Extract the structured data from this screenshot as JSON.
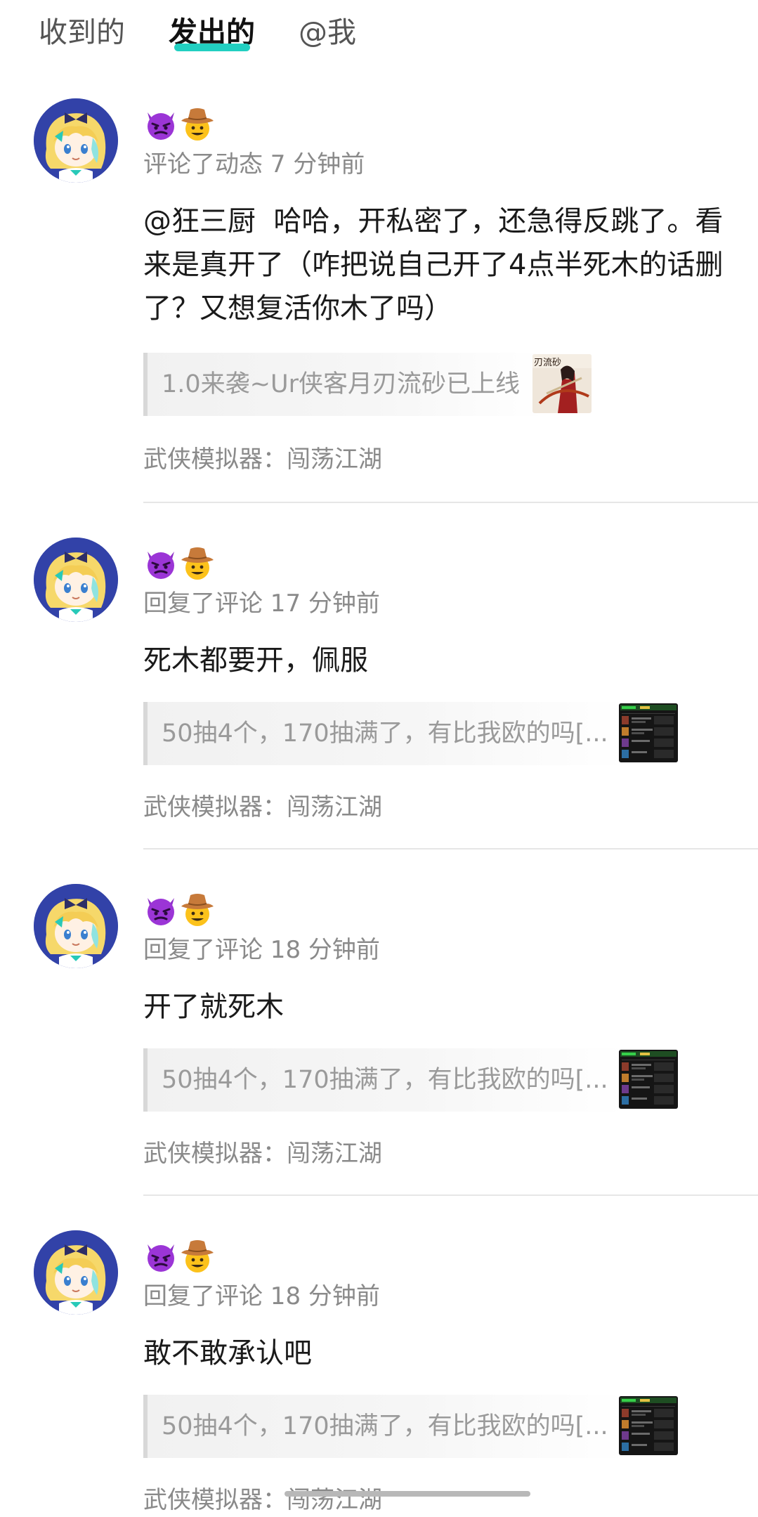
{
  "tabs": [
    {
      "label": "收到的",
      "active": false
    },
    {
      "label": "发出的",
      "active": true
    },
    {
      "label": "@我",
      "active": false
    }
  ],
  "accent_color": "#22cfc1",
  "comments": [
    {
      "emojis": [
        "smiling-face-with-horns-icon",
        "cowboy-hat-face-icon"
      ],
      "meta": "评论了动态 7 分钟前",
      "text": "@狂三厨  哈哈，开私密了，还急得反跳了。看来是真开了（咋把说自己开了4点半死木的话删了？又想复活你木了吗）",
      "quote": "1.0来袭~Ur侠客月刃流砂已上线",
      "quote_thumb_text": "刃流砂",
      "game": "武侠模拟器：闯荡江湖"
    },
    {
      "emojis": [
        "smiling-face-with-horns-icon",
        "cowboy-hat-face-icon"
      ],
      "meta": "回复了评论 17 分钟前",
      "text": "死木都要开，佩服",
      "quote": "50抽4个，170抽满了，有比我欧的吗[...",
      "game": "武侠模拟器：闯荡江湖"
    },
    {
      "emojis": [
        "smiling-face-with-horns-icon",
        "cowboy-hat-face-icon"
      ],
      "meta": "回复了评论 18 分钟前",
      "text": "开了就死木",
      "quote": "50抽4个，170抽满了，有比我欧的吗[...",
      "game": "武侠模拟器：闯荡江湖"
    },
    {
      "emojis": [
        "smiling-face-with-horns-icon",
        "cowboy-hat-face-icon"
      ],
      "meta": "回复了评论 18 分钟前",
      "text": "敢不敢承认吧",
      "quote": "50抽4个，170抽满了，有比我欧的吗[...",
      "game": "武侠模拟器：闯荡江湖"
    }
  ]
}
